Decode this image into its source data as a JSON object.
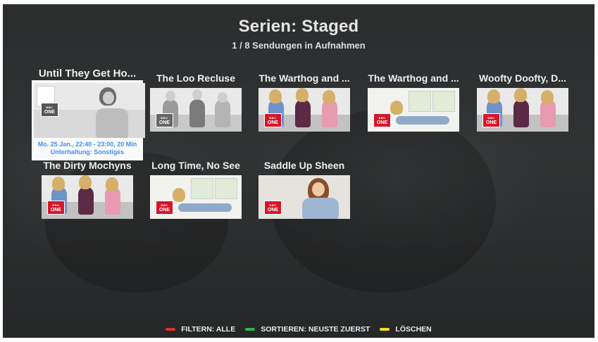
{
  "header": {
    "title": "Serien: Staged",
    "subtitle": "1 / 8 Sendungen in Aufnahmen"
  },
  "tiles": [
    {
      "title": "Until They Get Ho...",
      "focused": true,
      "info_line1": "Mo. 25 Jan., 22:40 - 23:00, 20 Min",
      "info_line2": "Unterhaltung: Sonstiges"
    },
    {
      "title": "The Loo Recluse"
    },
    {
      "title": "The Warthog and ..."
    },
    {
      "title": "The Warthog and ..."
    },
    {
      "title": "Woofty Doofty, D..."
    },
    {
      "title": "The Dirty Mochyns"
    },
    {
      "title": "Long Time, No See"
    },
    {
      "title": "Saddle Up Sheen"
    }
  ],
  "channel_logo": {
    "top": "BBC",
    "bottom": "ONE"
  },
  "footer": {
    "items": [
      {
        "color": "#e0312b",
        "label": "FILTERN: ALLE"
      },
      {
        "color": "#2fb54a",
        "label": "SORTIEREN: NEUSTE ZUERST"
      },
      {
        "color": "#f2e21b",
        "label": "LÖSCHEN"
      }
    ]
  }
}
